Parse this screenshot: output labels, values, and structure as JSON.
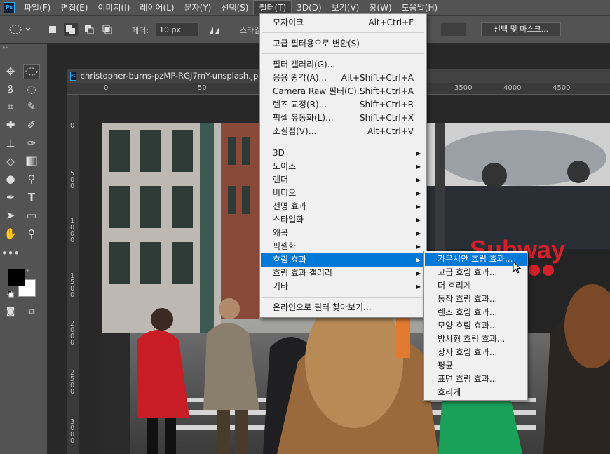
{
  "menubar": {
    "logo": "Ps",
    "items": [
      "파일(F)",
      "편집(E)",
      "이미지(I)",
      "레이어(L)",
      "문자(Y)",
      "선택(S)",
      "필터(T)",
      "3D(D)",
      "보기(V)",
      "창(W)",
      "도움말(H)"
    ]
  },
  "options": {
    "feather_label": "페더:",
    "feather_value": "10 px",
    "style_label": "스타일",
    "select_mask": "선택 및 마스크..."
  },
  "document": {
    "tab_title": "christopher-burns-pzMP-RGJ7mY-unsplash.jpg",
    "ruler_top": [
      "0",
      "50",
      "3500",
      "4000",
      "4500"
    ],
    "ruler_left": [
      "0",
      "5 0 0",
      "1 0 0 0",
      "1 5 0 0",
      "2 0 0 0",
      "2 5 0 0",
      "3 0 0 0"
    ]
  },
  "photo": {
    "sign_text": "Subway"
  },
  "filter_menu": {
    "items": [
      {
        "label": "모자이크",
        "shortcut": "Alt+Ctrl+F"
      },
      {
        "label": "고급 필터용으로 변환(S)",
        "shortcut": ""
      },
      {
        "label": "필터 갤러리(G)...",
        "shortcut": ""
      },
      {
        "label": "응용 광각(A)...",
        "shortcut": "Alt+Shift+Ctrl+A"
      },
      {
        "label": "Camera Raw 필터(C)...",
        "shortcut": "Shift+Ctrl+A"
      },
      {
        "label": "렌즈 교정(R)...",
        "shortcut": "Shift+Ctrl+R"
      },
      {
        "label": "픽셀 유동화(L)...",
        "shortcut": "Shift+Ctrl+X"
      },
      {
        "label": "소실점(V)...",
        "shortcut": "Alt+Ctrl+V"
      },
      {
        "label": "3D",
        "shortcut": ""
      },
      {
        "label": "노이즈",
        "shortcut": ""
      },
      {
        "label": "렌더",
        "shortcut": ""
      },
      {
        "label": "비디오",
        "shortcut": ""
      },
      {
        "label": "선명 효과",
        "shortcut": ""
      },
      {
        "label": "스타일화",
        "shortcut": ""
      },
      {
        "label": "왜곡",
        "shortcut": ""
      },
      {
        "label": "픽셀화",
        "shortcut": ""
      },
      {
        "label": "흐림 효과",
        "shortcut": ""
      },
      {
        "label": "흐림 효과 갤러리",
        "shortcut": ""
      },
      {
        "label": "기타",
        "shortcut": ""
      },
      {
        "label": "온라인으로 필터 찾아보기...",
        "shortcut": ""
      }
    ]
  },
  "blur_submenu": {
    "items": [
      "가우시안 흐림 효과...",
      "고급 흐림 효과...",
      "더 흐리게",
      "동작 흐림 효과...",
      "렌즈 흐림 효과...",
      "모양 흐림 효과...",
      "방사형 흐림 효과...",
      "상자 흐림 효과...",
      "평균",
      "표면 흐림 효과...",
      "흐리게"
    ]
  },
  "colors": {
    "accent": "#0078d7",
    "panel": "#535353",
    "menu_bg": "#f0f0f0",
    "sign_red": "#d4202a"
  }
}
